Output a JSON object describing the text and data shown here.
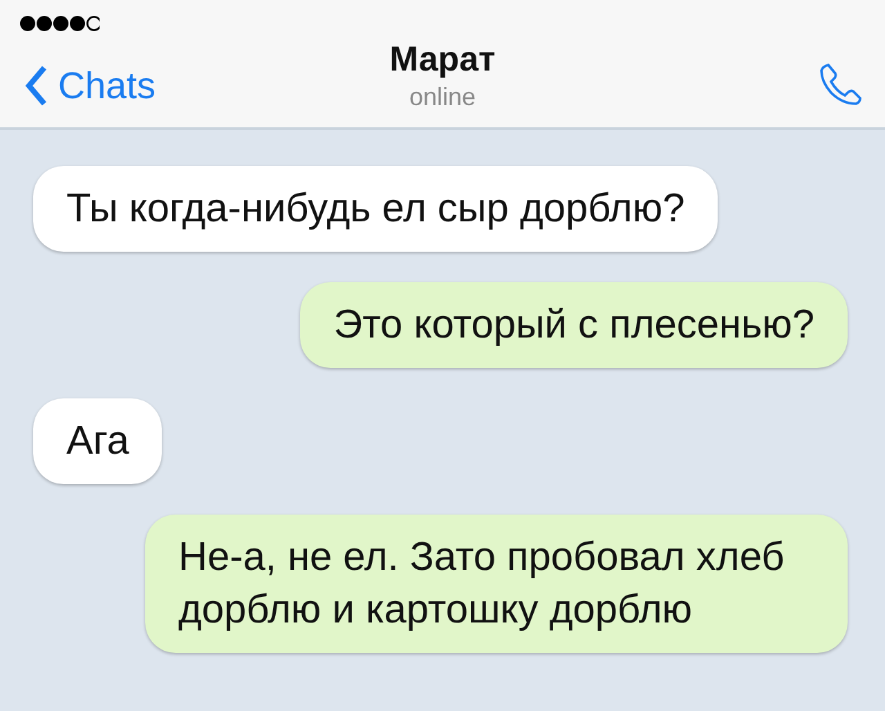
{
  "header": {
    "back": "Chats",
    "title": "Марат",
    "status": "online"
  },
  "messages": [
    {
      "kind": "incoming",
      "text": "Ты когда-нибудь ел сыр дорблю?"
    },
    {
      "kind": "outgoing",
      "text": "Это который с плесенью?"
    },
    {
      "kind": "incoming",
      "text": "Ага"
    },
    {
      "kind": "outgoing",
      "text": "Не-а, не ел. Зато пробовал хлеб дорблю и картошку дорблю"
    }
  ]
}
